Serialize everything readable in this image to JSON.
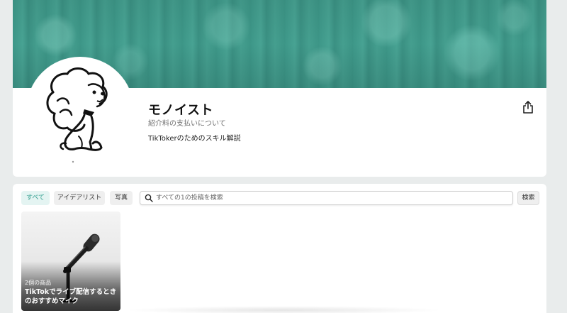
{
  "profile": {
    "name": "モノイスト",
    "fee_link": "紹介料の支払いについて",
    "bio": "TikTokerのためのスキル解説",
    "share_icon": "share-icon",
    "avatar_icon": "dog-illustration-icon"
  },
  "filters": {
    "tabs": [
      {
        "label": "すべて",
        "active": true
      },
      {
        "label": "アイデアリスト",
        "active": false
      },
      {
        "label": "写真",
        "active": false
      }
    ]
  },
  "search": {
    "placeholder": "すべての1の投稿を検索",
    "button_label": "検索",
    "icon": "search-icon"
  },
  "posts": [
    {
      "count_label": "2個の商品",
      "title": "TikTokでライブ配信するときのおすすめマイク",
      "image_icon": "microphone-icon"
    }
  ],
  "colors": {
    "banner": "#3f9b8c",
    "accent": "#2f9d8d",
    "active_tab_bg": "#e4f4f2",
    "page_bg": "#e9ecec"
  }
}
